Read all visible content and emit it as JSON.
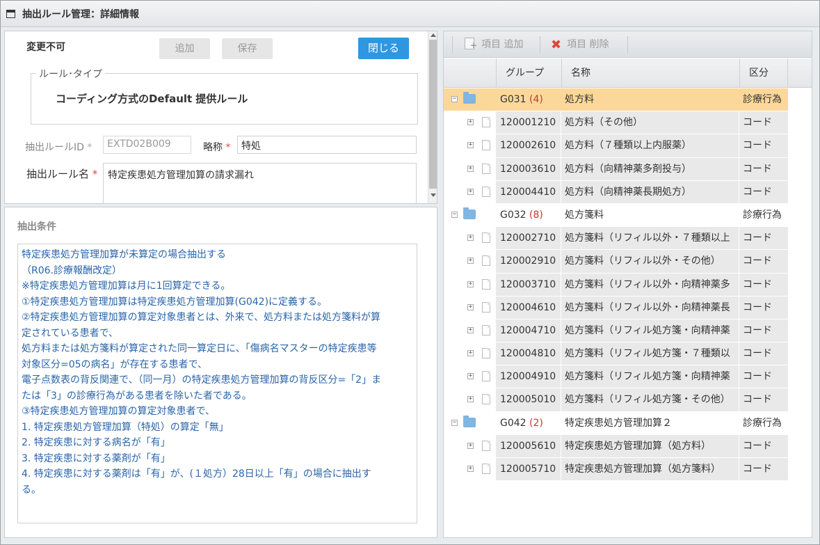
{
  "window": {
    "title": "抽出ルール管理：詳細情報"
  },
  "form": {
    "status_label": "変更不可",
    "add_button": "追加",
    "save_button": "保存",
    "close_button": "閉じる",
    "rule_type_legend": "ルール･タイプ",
    "rule_type_value": "コーディング方式のDefault 提供ルール",
    "rule_id_label": "抽出ルールID",
    "rule_id_value": "EXTD02B009",
    "short_name_label": "略称",
    "short_name_value": "特処",
    "rule_name_label": "抽出ルール名",
    "rule_name_value": "特定疾患処方管理加算の請求漏れ",
    "required_mark": "*"
  },
  "conditions": {
    "label": "抽出条件",
    "lines": [
      "特定疾患処方管理加算が未算定の場合抽出する",
      "（R06.診療報酬改定）",
      "※特定疾患処方管理加算は月に1回算定できる。",
      "①特定疾患処方管理加算は特定疾患処方管理加算(G042)に定義する。",
      "②特定疾患処方管理加算の算定対象患者とは、外来で、処方料または処方箋料が算",
      "定されている患者で、",
      "処方料または処方箋料が算定された同一算定日に、「傷病名マスターの特定疾患等",
      "対象区分=05の病名」が存在する患者で、",
      "電子点数表の背反関連で、（同一月）の特定疾患処方管理加算の背反区分=「2」ま",
      "たは「3」の診療行為がある患者を除いた者である。",
      "③特定疾患処方管理加算の算定対象患者で、",
      "1. 特定疾患処方管理加算（特処）の算定「無」",
      "2. 特定疾患に対する病名が「有」",
      "3. 特定疾患に対する薬剤が「有」",
      "4. 特定疾患に対する薬剤は「有」が、(１処方）28日以上「有」の場合に抽出す",
      "る。"
    ]
  },
  "toolbar": {
    "add_item": "項目 追加",
    "delete_item": "項目 削除"
  },
  "grid": {
    "headers": {
      "group": "グループ",
      "name": "名称",
      "kubun": "区分"
    },
    "rows": [
      {
        "type": "group",
        "code": "G031",
        "count": "(4)",
        "name": "処方料",
        "kubun": "診療行為",
        "selected": true
      },
      {
        "type": "child",
        "code": "120001210",
        "name": "処方料（その他）",
        "kubun": "コード"
      },
      {
        "type": "child",
        "code": "120002610",
        "name": "処方料（７種類以上内服薬）",
        "kubun": "コード"
      },
      {
        "type": "child",
        "code": "120003610",
        "name": "処方料（向精神薬多剤投与）",
        "kubun": "コード"
      },
      {
        "type": "child",
        "code": "120004410",
        "name": "処方料（向精神薬長期処方）",
        "kubun": "コード"
      },
      {
        "type": "group",
        "code": "G032",
        "count": "(8)",
        "name": "処方箋料",
        "kubun": "診療行為"
      },
      {
        "type": "child",
        "code": "120002710",
        "name": "処方箋料（リフィル以外・７種類以上",
        "kubun": "コード"
      },
      {
        "type": "child",
        "code": "120002910",
        "name": "処方箋料（リフィル以外・その他）",
        "kubun": "コード"
      },
      {
        "type": "child",
        "code": "120003710",
        "name": "処方箋料（リフィル以外・向精神薬多",
        "kubun": "コード"
      },
      {
        "type": "child",
        "code": "120004610",
        "name": "処方箋料（リフィル以外・向精神薬長",
        "kubun": "コード"
      },
      {
        "type": "child",
        "code": "120004710",
        "name": "処方箋料（リフィル処方箋・向精神薬",
        "kubun": "コード"
      },
      {
        "type": "child",
        "code": "120004810",
        "name": "処方箋料（リフィル処方箋・７種類以",
        "kubun": "コード"
      },
      {
        "type": "child",
        "code": "120004910",
        "name": "処方箋料（リフィル処方箋・向精神薬",
        "kubun": "コード"
      },
      {
        "type": "child",
        "code": "120005010",
        "name": "処方箋料（リフィル処方箋・その他）",
        "kubun": "コード"
      },
      {
        "type": "group",
        "code": "G042",
        "count": "(2)",
        "name": "特定疾患処方管理加算２",
        "kubun": "診療行為"
      },
      {
        "type": "child",
        "code": "120005610",
        "name": "特定疾患処方管理加算（処方料）",
        "kubun": "コード"
      },
      {
        "type": "child",
        "code": "120005710",
        "name": "特定疾患処方管理加算（処方箋料）",
        "kubun": "コード"
      }
    ]
  }
}
